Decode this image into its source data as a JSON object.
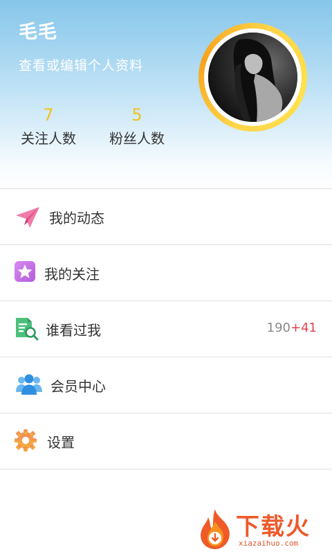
{
  "profile": {
    "username": "毛毛",
    "edit_link": "查看或编辑个人资料",
    "stats": [
      {
        "value": "7",
        "label": "关注人数"
      },
      {
        "value": "5",
        "label": "粉丝人数"
      }
    ]
  },
  "menu": {
    "items": [
      {
        "label": "我的动态",
        "icon": "paper-plane-icon"
      },
      {
        "label": "我的关注",
        "icon": "star-icon"
      },
      {
        "label": "谁看过我",
        "icon": "visitor-search-icon",
        "count": "190",
        "count_plus": "+41"
      },
      {
        "label": "会员中心",
        "icon": "members-icon"
      },
      {
        "label": "设置",
        "icon": "gear-icon"
      }
    ]
  },
  "watermark": {
    "text": "下载火",
    "sub": "xiazaihuo.com"
  },
  "colors": {
    "stat_value": "#f2c21b",
    "count_plus": "#e0454f",
    "brand_orange": "#ee5a2b"
  }
}
